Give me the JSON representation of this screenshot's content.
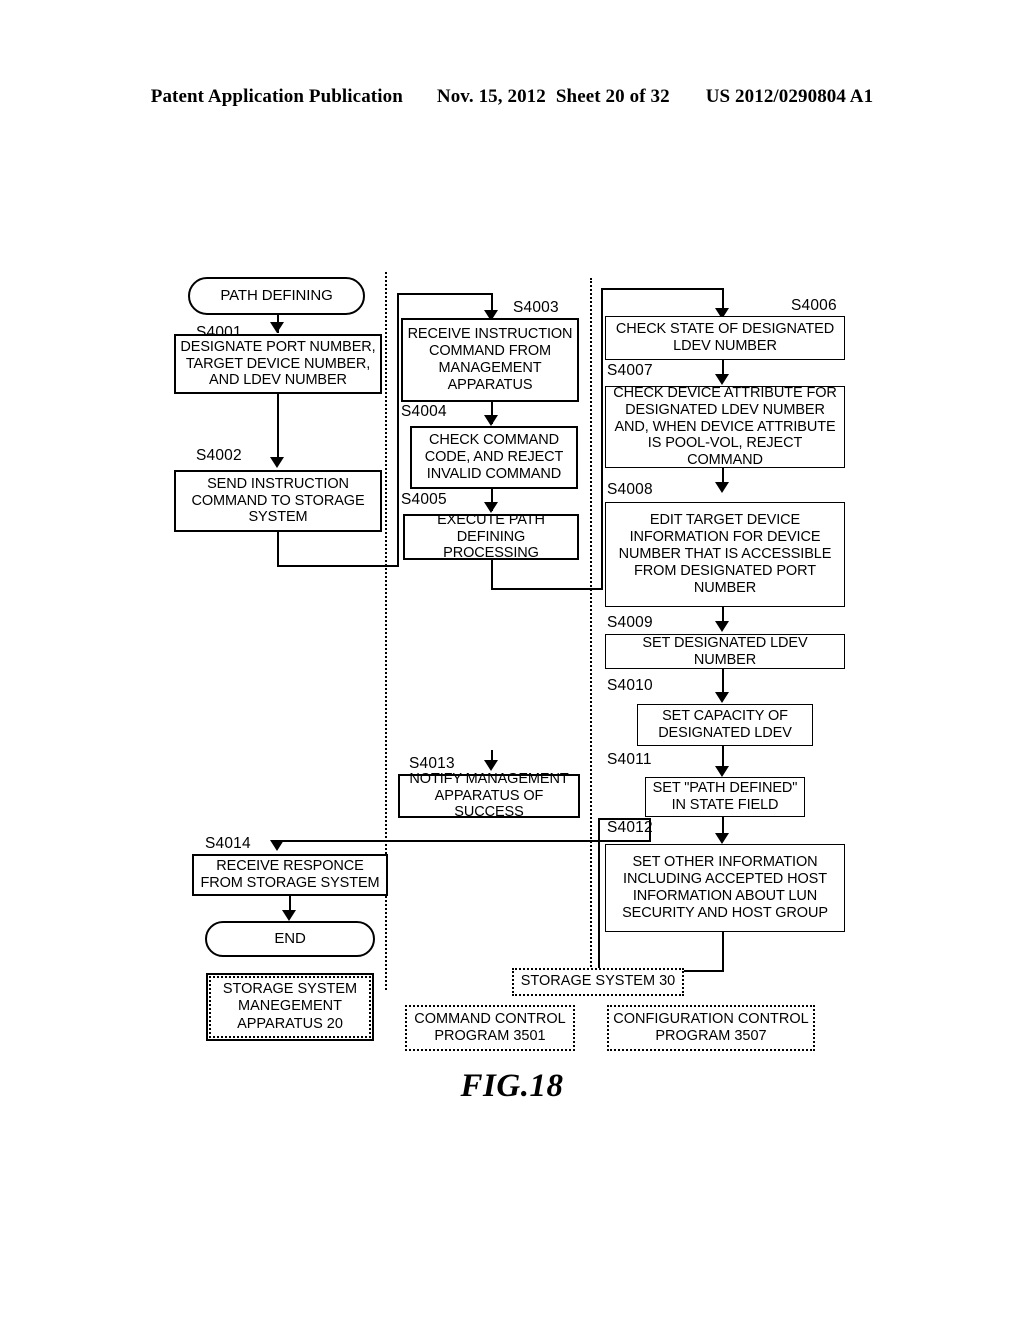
{
  "header": {
    "publication": "Patent Application Publication",
    "date": "Nov. 15, 2012",
    "sheet": "Sheet 20 of 32",
    "doc_number": "US 2012/0290804 A1"
  },
  "figure": {
    "caption": "FIG.18",
    "nodes": {
      "start": "PATH DEFINING",
      "s4001": "DESIGNATE PORT NUMBER, TARGET DEVICE NUMBER, AND LDEV NUMBER",
      "s4002": "SEND INSTRUCTION COMMAND TO STORAGE SYSTEM",
      "s4003": "RECEIVE INSTRUCTION COMMAND FROM MANAGEMENT APPARATUS",
      "s4004": "CHECK COMMAND CODE, AND REJECT INVALID COMMAND",
      "s4005": "EXECUTE PATH DEFINING PROCESSING",
      "s4006": "CHECK STATE OF DESIGNATED LDEV NUMBER",
      "s4007": "CHECK DEVICE ATTRIBUTE FOR DESIGNATED LDEV NUMBER AND, WHEN DEVICE ATTRIBUTE IS POOL-VOL, REJECT COMMAND",
      "s4008": "EDIT TARGET DEVICE INFORMATION FOR DEVICE NUMBER THAT IS ACCESSIBLE FROM DESIGNATED PORT NUMBER",
      "s4009": "SET DESIGNATED LDEV NUMBER",
      "s4010": "SET CAPACITY OF DESIGNATED LDEV",
      "s4011": "SET \"PATH DEFINED\" IN STATE FIELD",
      "s4012": "SET OTHER INFORMATION INCLUDING ACCEPTED HOST INFORMATION ABOUT LUN SECURITY AND HOST GROUP",
      "s4013": "NOTIFY MANAGEMENT APPARATUS OF SUCCESS",
      "s4014": "RECEIVE RESPONCE FROM STORAGE SYSTEM",
      "end": "END"
    },
    "step_labels": {
      "s4001": "S4001",
      "s4002": "S4002",
      "s4003": "S4003",
      "s4004": "S4004",
      "s4005": "S4005",
      "s4006": "S4006",
      "s4007": "S4007",
      "s4008": "S4008",
      "s4009": "S4009",
      "s4010": "S4010",
      "s4011": "S4011",
      "s4012": "S4012",
      "s4013": "S4013",
      "s4014": "S4014"
    },
    "legend": {
      "management_apparatus": "STORAGE SYSTEM MANEGEMENT APPARATUS 20",
      "storage_system": "STORAGE SYSTEM 30",
      "command_control": "COMMAND CONTROL PROGRAM 3501",
      "configuration_control": "CONFIGURATION CONTROL PROGRAM 3507"
    }
  }
}
